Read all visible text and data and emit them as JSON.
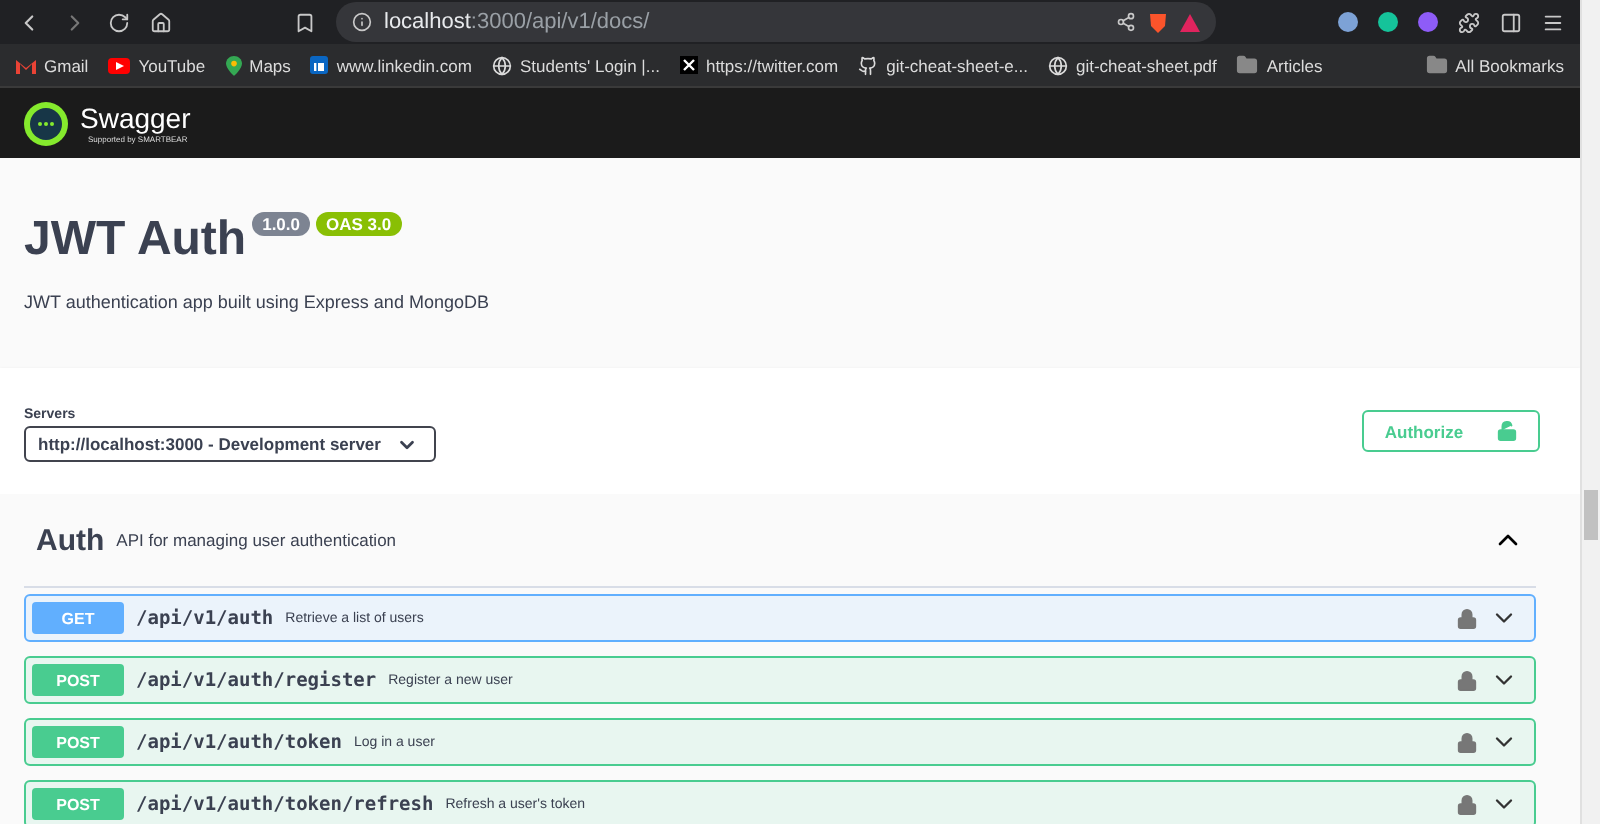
{
  "browser": {
    "url_host": "localhost",
    "url_path": ":3000/api/v1/docs/"
  },
  "bookmarks": [
    {
      "label": "Gmail",
      "kind": "gmail"
    },
    {
      "label": "YouTube",
      "kind": "youtube"
    },
    {
      "label": "Maps",
      "kind": "maps"
    },
    {
      "label": "www.linkedin.com",
      "kind": "linkedin"
    },
    {
      "label": "Students' Login |...",
      "kind": "globe"
    },
    {
      "label": "https://twitter.com",
      "kind": "x"
    },
    {
      "label": "git-cheat-sheet-e...",
      "kind": "github"
    },
    {
      "label": "git-cheat-sheet.pdf",
      "kind": "globe"
    },
    {
      "label": "Articles",
      "kind": "folder"
    }
  ],
  "all_bookmarks": "All Bookmarks",
  "swagger": {
    "brand": "Swagger",
    "tagline": "Supported by SMARTBEAR"
  },
  "info": {
    "title": "JWT Auth",
    "version": "1.0.0",
    "oas": "OAS 3.0",
    "description": "JWT authentication app built using Express and MongoDB"
  },
  "servers": {
    "label": "Servers",
    "selected": "http://localhost:3000 - Development server"
  },
  "authorize": "Authorize",
  "tag": {
    "name": "Auth",
    "description": "API for managing user authentication",
    "expanded": true
  },
  "operations": [
    {
      "method": "GET",
      "kind": "get",
      "path": "/api/v1/auth",
      "summary": "Retrieve a list of users"
    },
    {
      "method": "POST",
      "kind": "post",
      "path": "/api/v1/auth/register",
      "summary": "Register a new user"
    },
    {
      "method": "POST",
      "kind": "post",
      "path": "/api/v1/auth/token",
      "summary": "Log in a user"
    },
    {
      "method": "POST",
      "kind": "post",
      "path": "/api/v1/auth/token/refresh",
      "summary": "Refresh a user's token"
    }
  ]
}
